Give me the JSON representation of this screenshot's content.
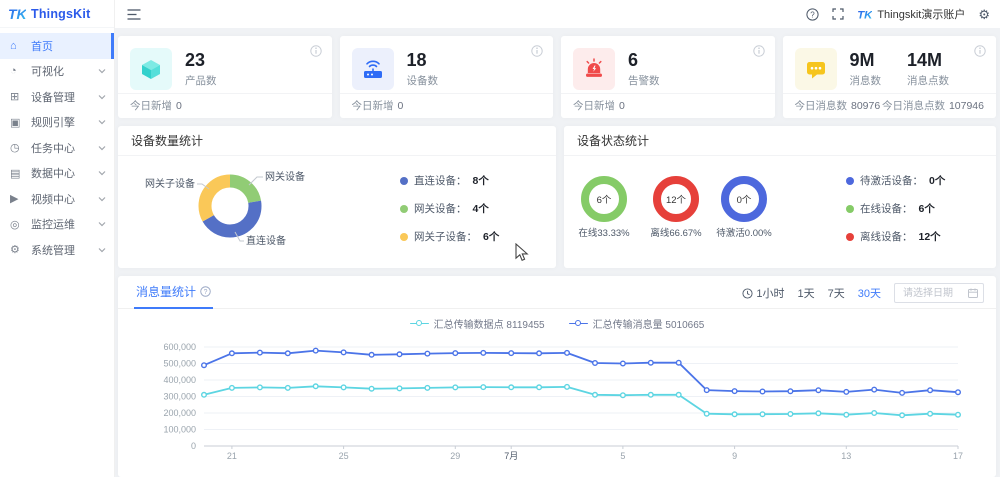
{
  "brand": {
    "logo_text": "TK",
    "name": "ThingsKit"
  },
  "header": {
    "account": "Thingskit演示账户"
  },
  "sidebar": {
    "items": [
      {
        "id": "home",
        "icon": "home-icon",
        "glyph": "⌂",
        "label": "首页",
        "active": true,
        "chevron": false
      },
      {
        "id": "visualization",
        "icon": "visualization-icon",
        "glyph": "◔",
        "label": "可视化",
        "active": false,
        "chevron": true
      },
      {
        "id": "device-management",
        "icon": "device-icon",
        "glyph": "⊞",
        "label": "设备管理",
        "active": false,
        "chevron": true
      },
      {
        "id": "rule-engine",
        "icon": "rule-engine-icon",
        "glyph": "▣",
        "label": "规则引擎",
        "active": false,
        "chevron": true
      },
      {
        "id": "task-center",
        "icon": "task-icon",
        "glyph": "◷",
        "label": "任务中心",
        "active": false,
        "chevron": true
      },
      {
        "id": "data-center",
        "icon": "data-icon",
        "glyph": "▤",
        "label": "数据中心",
        "active": false,
        "chevron": true
      },
      {
        "id": "video-center",
        "icon": "video-icon",
        "glyph": "▶",
        "label": "视频中心",
        "active": false,
        "chevron": true
      },
      {
        "id": "monitor-ops",
        "icon": "monitor-icon",
        "glyph": "◎",
        "label": "监控运维",
        "active": false,
        "chevron": true
      },
      {
        "id": "system-management",
        "icon": "system-icon",
        "glyph": "⚙",
        "label": "系统管理",
        "active": false,
        "chevron": true
      }
    ]
  },
  "stats": {
    "cards": [
      {
        "value": "23",
        "label": "产品数",
        "icon": "cube-icon",
        "icon_bg": "#e5fafa",
        "footer_label": "今日新增",
        "footer_value": "0"
      },
      {
        "value": "18",
        "label": "设备数",
        "icon": "gateway-icon",
        "icon_bg": "#ecf0fc",
        "footer_label": "今日新增",
        "footer_value": "0"
      },
      {
        "value": "6",
        "label": "告警数",
        "icon": "alarm-icon",
        "icon_bg": "#fdecec",
        "footer_label": "今日新增",
        "footer_value": "0"
      },
      {
        "value": "9M",
        "label": "消息数",
        "value2": "14M",
        "label2": "消息点数",
        "icon": "message-icon",
        "icon_bg": "#fbf8e6",
        "footer_left_label": "今日消息数",
        "footer_left_value": "80976",
        "footer_right_label": "今日消息点数",
        "footer_right_value": "107946"
      }
    ]
  },
  "device_count_panel": {
    "title": "设备数量统计",
    "legend": [
      {
        "label": "直连设备：",
        "value": "8个",
        "color": "#5470c6"
      },
      {
        "label": "网关设备：",
        "value": "4个",
        "color": "#91cc75"
      },
      {
        "label": "网关子设备：",
        "value": "6个",
        "color": "#fac858"
      }
    ]
  },
  "device_status_panel": {
    "title": "设备状态统计",
    "rings": [
      {
        "count": "6个",
        "label": "在线33.33%",
        "color": "#85cb67"
      },
      {
        "count": "12个",
        "label": "离线66.67%",
        "color": "#e6403a"
      },
      {
        "count": "0个",
        "label": "待激活0.00%",
        "color": "#4d68dd"
      }
    ],
    "legend": [
      {
        "label": "待激活设备：",
        "value": "0个",
        "color": "#4d68dd"
      },
      {
        "label": "在线设备：",
        "value": "6个",
        "color": "#85cb67"
      },
      {
        "label": "离线设备：",
        "value": "12个",
        "color": "#e6403a"
      }
    ]
  },
  "message_panel": {
    "tab": "消息量统计",
    "filters": [
      {
        "label": "1小时",
        "icon": "clock-icon",
        "active": false
      },
      {
        "label": "1天",
        "active": false
      },
      {
        "label": "7天",
        "active": false
      },
      {
        "label": "30天",
        "active": true
      }
    ],
    "date_placeholder": "请选择日期"
  },
  "chart_data": [
    {
      "type": "line",
      "title": "消息量统计",
      "legend_position": "top-center",
      "grid": true,
      "ylim": [
        0,
        600000
      ],
      "y_ticks": [
        0,
        100000,
        200000,
        300000,
        400000,
        500000,
        600000
      ],
      "x_tick_indices": [
        1,
        5,
        9,
        11,
        15,
        19,
        23,
        27
      ],
      "x_tick_labels": [
        "21",
        "25",
        "29",
        "7月",
        "5",
        "9",
        "13",
        "17"
      ],
      "series": [
        {
          "name": "汇总传输数据点 8119455",
          "color": "#5dd5e2",
          "values": [
            310000,
            352000,
            355000,
            352000,
            362000,
            355000,
            347000,
            349000,
            352000,
            355000,
            357000,
            356000,
            356000,
            358000,
            310000,
            308000,
            310000,
            310000,
            196000,
            192000,
            193000,
            194000,
            198000,
            190000,
            200000,
            186000,
            196000,
            190000
          ]
        },
        {
          "name": "汇总传输消息量 5010665",
          "color": "#4b74e8",
          "values": [
            490000,
            562000,
            566000,
            562000,
            578000,
            567000,
            553000,
            556000,
            560000,
            563000,
            564000,
            563000,
            562000,
            564000,
            503000,
            500000,
            505000,
            505000,
            339000,
            333000,
            330000,
            332000,
            338000,
            328000,
            342000,
            322000,
            338000,
            326000
          ]
        }
      ]
    },
    {
      "type": "pie",
      "title": "设备数量统计",
      "donut": true,
      "slices": [
        {
          "name": "网关设备",
          "value": 4,
          "color": "#91cc75"
        },
        {
          "name": "直连设备",
          "value": 8,
          "color": "#5470c6"
        },
        {
          "name": "网关子设备",
          "value": 6,
          "color": "#fac858"
        }
      ]
    },
    {
      "type": "pie",
      "title": "设备状态统计",
      "rings": [
        {
          "name": "在线",
          "count": 6,
          "percent": 33.33,
          "color": "#85cb67"
        },
        {
          "name": "离线",
          "count": 12,
          "percent": 66.67,
          "color": "#e6403a"
        },
        {
          "name": "待激活",
          "count": 0,
          "percent": 0.0,
          "color": "#4d68dd"
        }
      ]
    }
  ]
}
